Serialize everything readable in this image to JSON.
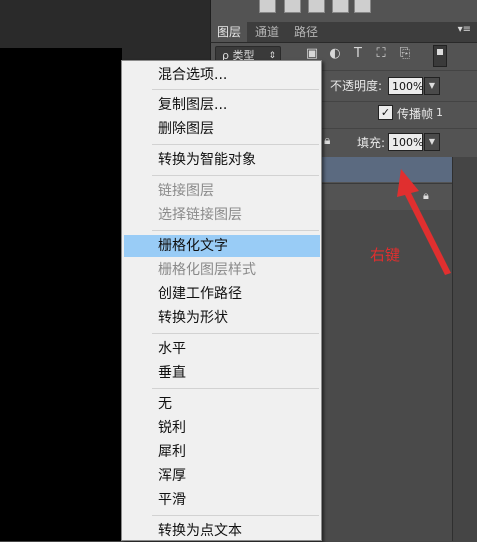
{
  "layers_panel": {
    "tabs": [
      "图层",
      "通道",
      "路径"
    ],
    "panel_menu_glyph": "▾≡",
    "filter": {
      "kind_label": "ρ 类型",
      "kind_arrow": "⇕"
    },
    "opacity": {
      "label": "不透明度:",
      "value": "100%"
    },
    "propagate": {
      "checked": true,
      "label": "传播帧",
      "frame": "1"
    },
    "fill": {
      "label": "填充:",
      "value": "100%"
    }
  },
  "annotation": {
    "text": "右键",
    "color": "#e02f2f"
  },
  "context_menu": {
    "items": [
      {
        "label": "混合选项...",
        "disabled": false
      },
      {
        "label": "复制图层...",
        "disabled": false
      },
      {
        "label": "删除图层",
        "disabled": false
      },
      {
        "label": "转换为智能对象",
        "disabled": false
      },
      {
        "label": "链接图层",
        "disabled": true
      },
      {
        "label": "选择链接图层",
        "disabled": true
      },
      {
        "label": "栅格化文字",
        "disabled": false,
        "highlighted": true
      },
      {
        "label": "栅格化图层样式",
        "disabled": true
      },
      {
        "label": "创建工作路径",
        "disabled": false
      },
      {
        "label": "转换为形状",
        "disabled": false
      },
      {
        "label": "水平",
        "disabled": false
      },
      {
        "label": "垂直",
        "disabled": false
      },
      {
        "label": "无",
        "disabled": false
      },
      {
        "label": "锐利",
        "disabled": false
      },
      {
        "label": "犀利",
        "disabled": false
      },
      {
        "label": "浑厚",
        "disabled": false
      },
      {
        "label": "平滑",
        "disabled": false
      },
      {
        "label": "转换为点文本",
        "disabled": false
      }
    ],
    "highlight_color": "#99ccf6"
  }
}
